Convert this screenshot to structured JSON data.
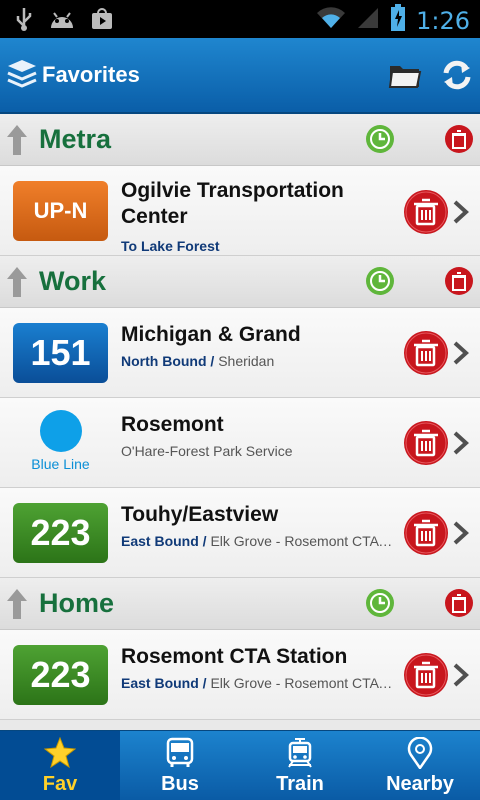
{
  "status_bar": {
    "time": "1:26",
    "icons": [
      "usb-icon",
      "android-icon",
      "play-store-icon",
      "wifi-icon",
      "signal-icon",
      "battery-icon"
    ]
  },
  "app_bar": {
    "title": "Favorites",
    "icons": [
      "layers-icon",
      "folder-icon",
      "refresh-icon"
    ]
  },
  "groups": [
    {
      "name": "Metra",
      "items": [
        {
          "badge": "UP-N",
          "badge_color": "#d8681c",
          "title": "Ogilvie Transportation Center",
          "direction": "To Lake Forest",
          "destination": ""
        }
      ]
    },
    {
      "name": "Work",
      "items": [
        {
          "badge": "151",
          "badge_color": "#0d63b3",
          "title": "Michigan & Grand",
          "direction": "North Bound /",
          "destination": "Sheridan"
        },
        {
          "badge": "Blue Line",
          "badge_color": "#0ea0e8",
          "title": "Rosemont",
          "direction": "",
          "destination": "O'Hare-Forest Park Service"
        },
        {
          "badge": "223",
          "badge_color": "#3d8c28",
          "title": "Touhy/Eastview",
          "direction": "East Bound /",
          "destination": "Elk Grove - Rosemont CTA Station"
        }
      ]
    },
    {
      "name": "Home",
      "items": [
        {
          "badge": "223",
          "badge_color": "#3d8c28",
          "title": "Rosemont CTA Station",
          "direction": "East Bound /",
          "destination": "Elk Grove - Rosemont CTA Station"
        }
      ]
    }
  ],
  "tabs": [
    {
      "label": "Fav",
      "icon": "star-icon",
      "active": true
    },
    {
      "label": "Bus",
      "icon": "bus-icon",
      "active": false
    },
    {
      "label": "Train",
      "icon": "train-icon",
      "active": false
    },
    {
      "label": "Nearby",
      "icon": "location-pin-icon",
      "active": false
    }
  ],
  "colors": {
    "accent": "#0a5ea8",
    "group_title": "#17703d",
    "delete_red": "#c8161d",
    "active_tab_label": "#ffd12a"
  }
}
